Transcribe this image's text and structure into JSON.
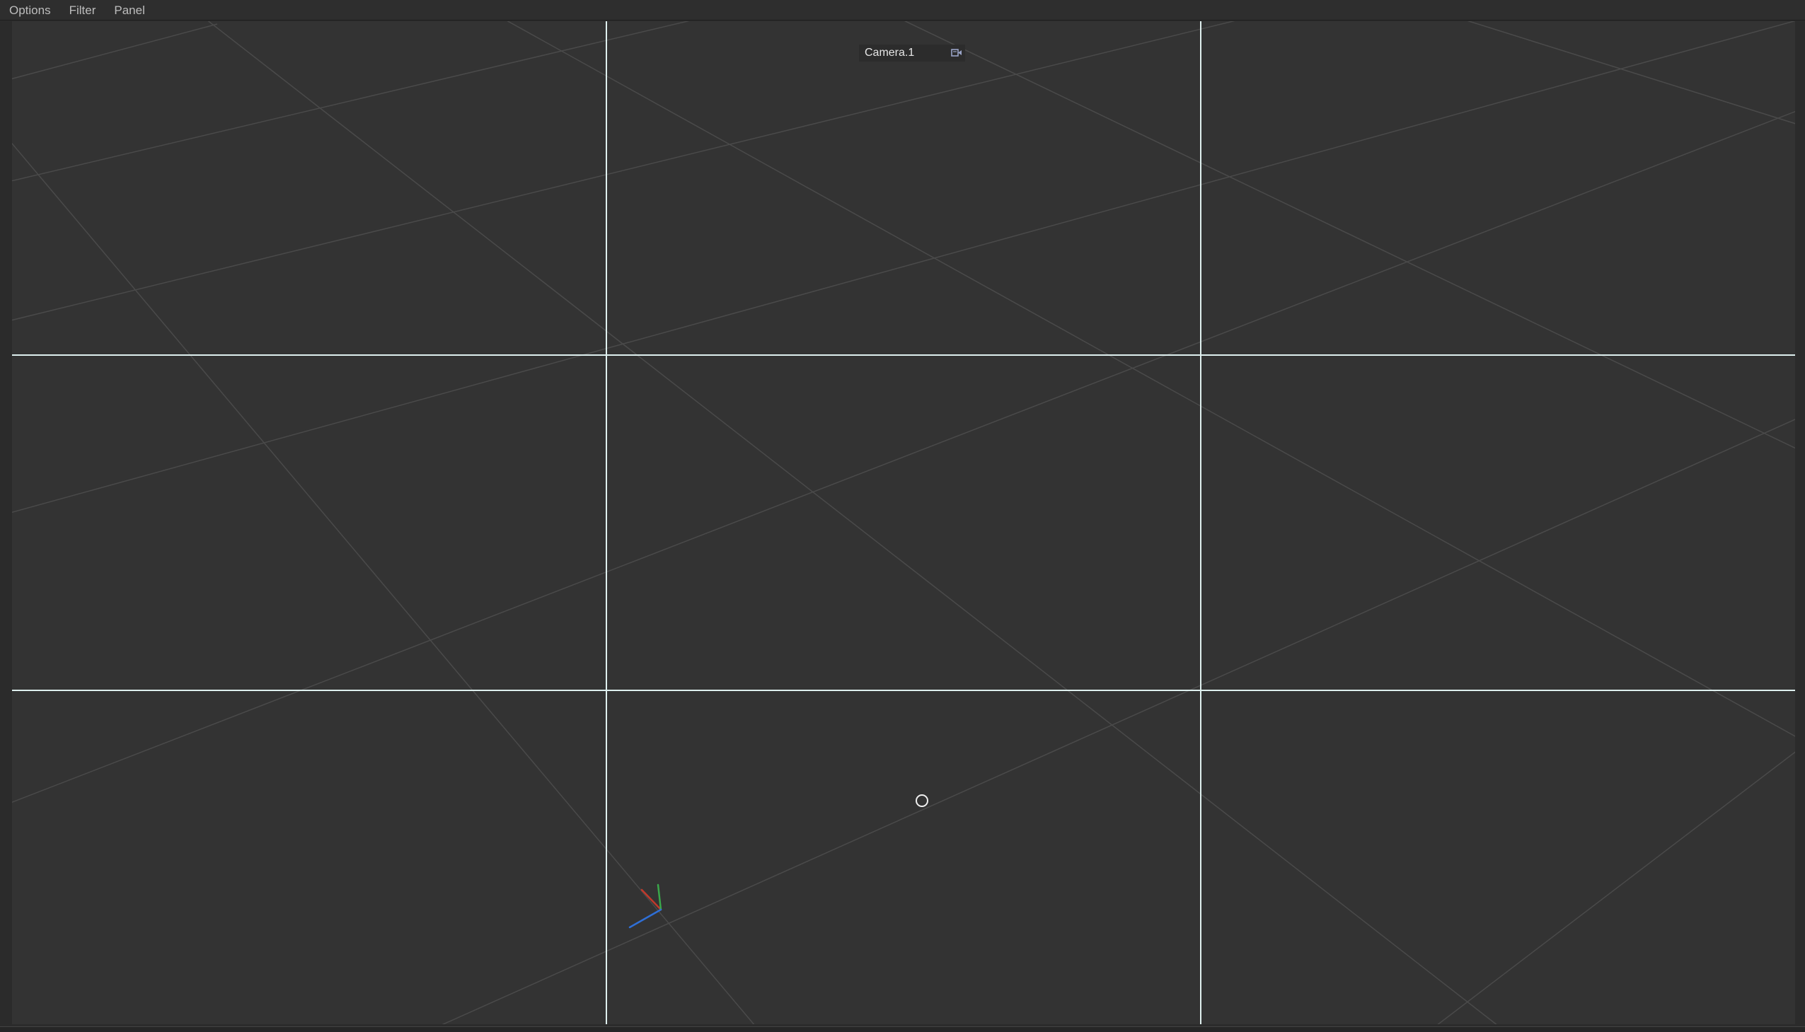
{
  "menu": {
    "items": [
      "Options",
      "Filter",
      "Panel"
    ]
  },
  "viewport": {
    "camera_label": "Camera.1",
    "camera_icon": "camera-icon",
    "grid_color": "#4a4a4a",
    "guide_color": "#e6f2f2",
    "axis_colors": {
      "x": "#c0392b",
      "y": "#3aa84a",
      "z": "#2f6fd6"
    }
  }
}
